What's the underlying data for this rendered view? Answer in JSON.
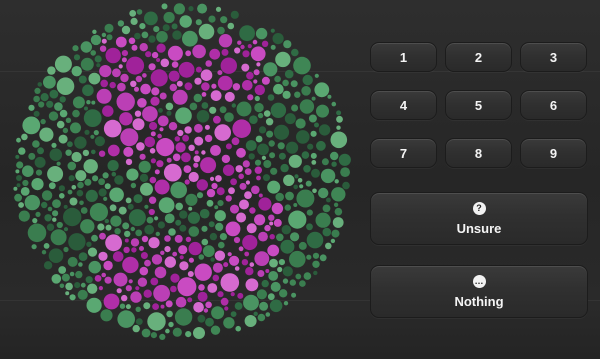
{
  "plate": {
    "colors": {
      "greens": [
        "#2f6b44",
        "#3a7d4f",
        "#4a9462",
        "#5aa872",
        "#2a5c3b",
        "#68b07c",
        "#3f8655"
      ],
      "magentas": [
        "#b02ea8",
        "#c94bc2",
        "#a0229a",
        "#d66ad0",
        "#bb3fb5"
      ]
    }
  },
  "keypad": {
    "digits": [
      "1",
      "2",
      "3",
      "4",
      "5",
      "6",
      "7",
      "8",
      "9"
    ],
    "unsure": {
      "icon": "?",
      "label": "Unsure"
    },
    "nothing": {
      "icon": "…",
      "label": "Nothing"
    }
  }
}
